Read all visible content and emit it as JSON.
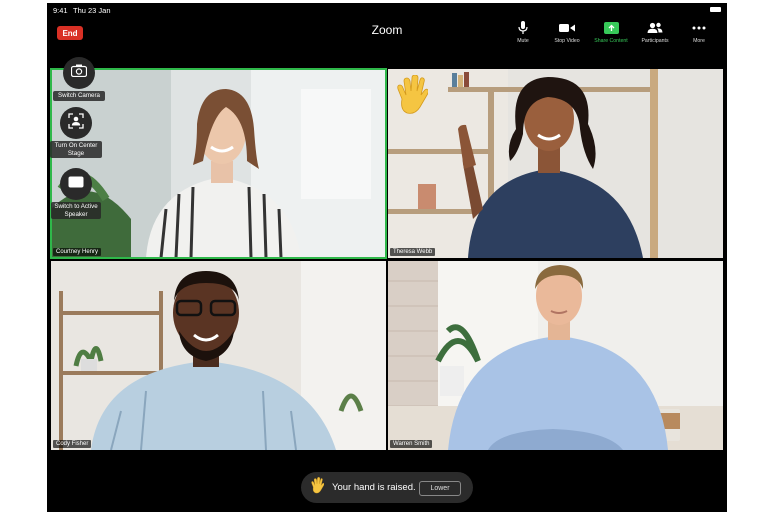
{
  "status": {
    "time": "9:41",
    "date": "Thu 23 Jan"
  },
  "header": {
    "end_label": "End",
    "title": "Zoom"
  },
  "toolbar": {
    "items": [
      {
        "label": "Mute",
        "icon": "microphone-icon"
      },
      {
        "label": "Stop Video",
        "icon": "video-camera-icon"
      },
      {
        "label": "Share Content",
        "icon": "share-screen-icon"
      },
      {
        "label": "Participants",
        "icon": "participants-icon"
      },
      {
        "label": "More",
        "icon": "more-dots-icon"
      }
    ],
    "share_color": "#37c959"
  },
  "side_controls": [
    {
      "label": "Switch Camera",
      "icon": "switch-camera-icon"
    },
    {
      "label": "Turn On Center Stage",
      "icon": "center-stage-icon"
    },
    {
      "label": "Switch to Active Speaker",
      "icon": "active-speaker-icon"
    }
  ],
  "participants": [
    {
      "name": "Courtney Henry",
      "active": true
    },
    {
      "name": "Theresa Webb",
      "hand_raised": true
    },
    {
      "name": "Cody Fisher"
    },
    {
      "name": "Warren Smith"
    }
  ],
  "toast": {
    "message": "Your hand is raised.",
    "button": "Lower"
  },
  "colors": {
    "end": "#d93025",
    "active_border": "#2fb84a",
    "background": "#000000"
  }
}
